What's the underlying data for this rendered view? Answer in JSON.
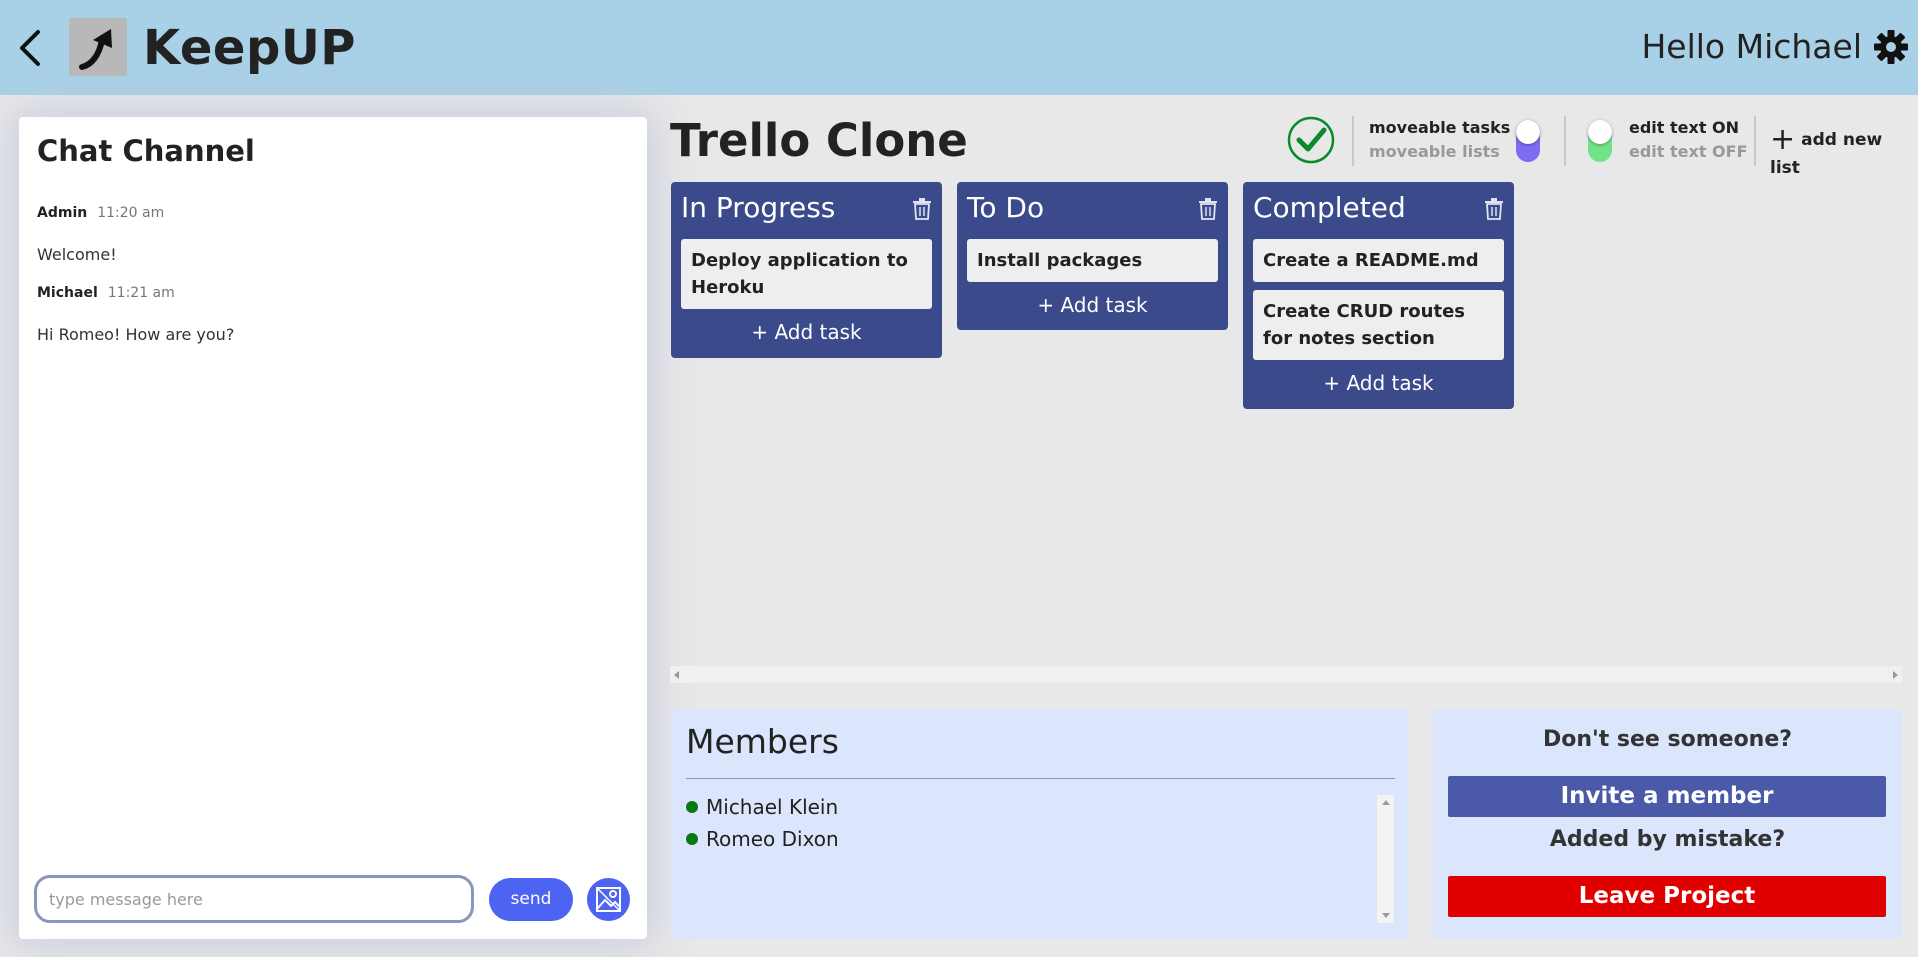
{
  "header": {
    "app_title": "KeepUP",
    "greeting": "Hello Michael",
    "icons": [
      "back-chevron-icon",
      "arrow-up-logo-icon",
      "gear-icon"
    ]
  },
  "chat": {
    "title": "Chat Channel",
    "messages": [
      {
        "author": "Admin",
        "time": "11:20 am",
        "text": "Welcome!"
      },
      {
        "author": "Michael",
        "time": "11:21 am",
        "text": "Hi Romeo! How are you?"
      }
    ],
    "input_placeholder": "type message here",
    "send_label": "send",
    "image_button_icon": "image-map-icon"
  },
  "board": {
    "title": "Trello Clone",
    "toggles": [
      {
        "on_label": "moveable tasks",
        "off_label": "moveable lists",
        "state": "on",
        "color": "#7b6cf0"
      },
      {
        "on_label": "edit text ON",
        "off_label": "edit text OFF",
        "state": "off",
        "color": "#6fe28a"
      }
    ],
    "add_list_label": "add new list",
    "add_task_label": "+ Add task",
    "lists": [
      {
        "title": "In Progress",
        "tasks": [
          "Deploy application to Heroku"
        ]
      },
      {
        "title": "To Do",
        "tasks": [
          "Install packages"
        ]
      },
      {
        "title": "Completed",
        "tasks": [
          "Create a README.md",
          "Create CRUD routes for notes section"
        ]
      }
    ]
  },
  "members": {
    "title": "Members",
    "list": [
      {
        "name": "Michael Klein",
        "status": "online"
      },
      {
        "name": "Romeo Dixon",
        "status": "online"
      }
    ]
  },
  "invite": {
    "question1": "Don't see someone?",
    "invite_label": "Invite a member",
    "question2": "Added by mistake?",
    "leave_label": "Leave Project"
  },
  "colors": {
    "header_bg": "#a8d0e6",
    "list_bg": "#3a4a8a",
    "accent_blue": "#4d63f2",
    "invite_btn": "#4a5aa8",
    "leave_btn": "#e00000",
    "panel_bg": "#dbe5fb",
    "online_dot": "#0a7a14"
  }
}
